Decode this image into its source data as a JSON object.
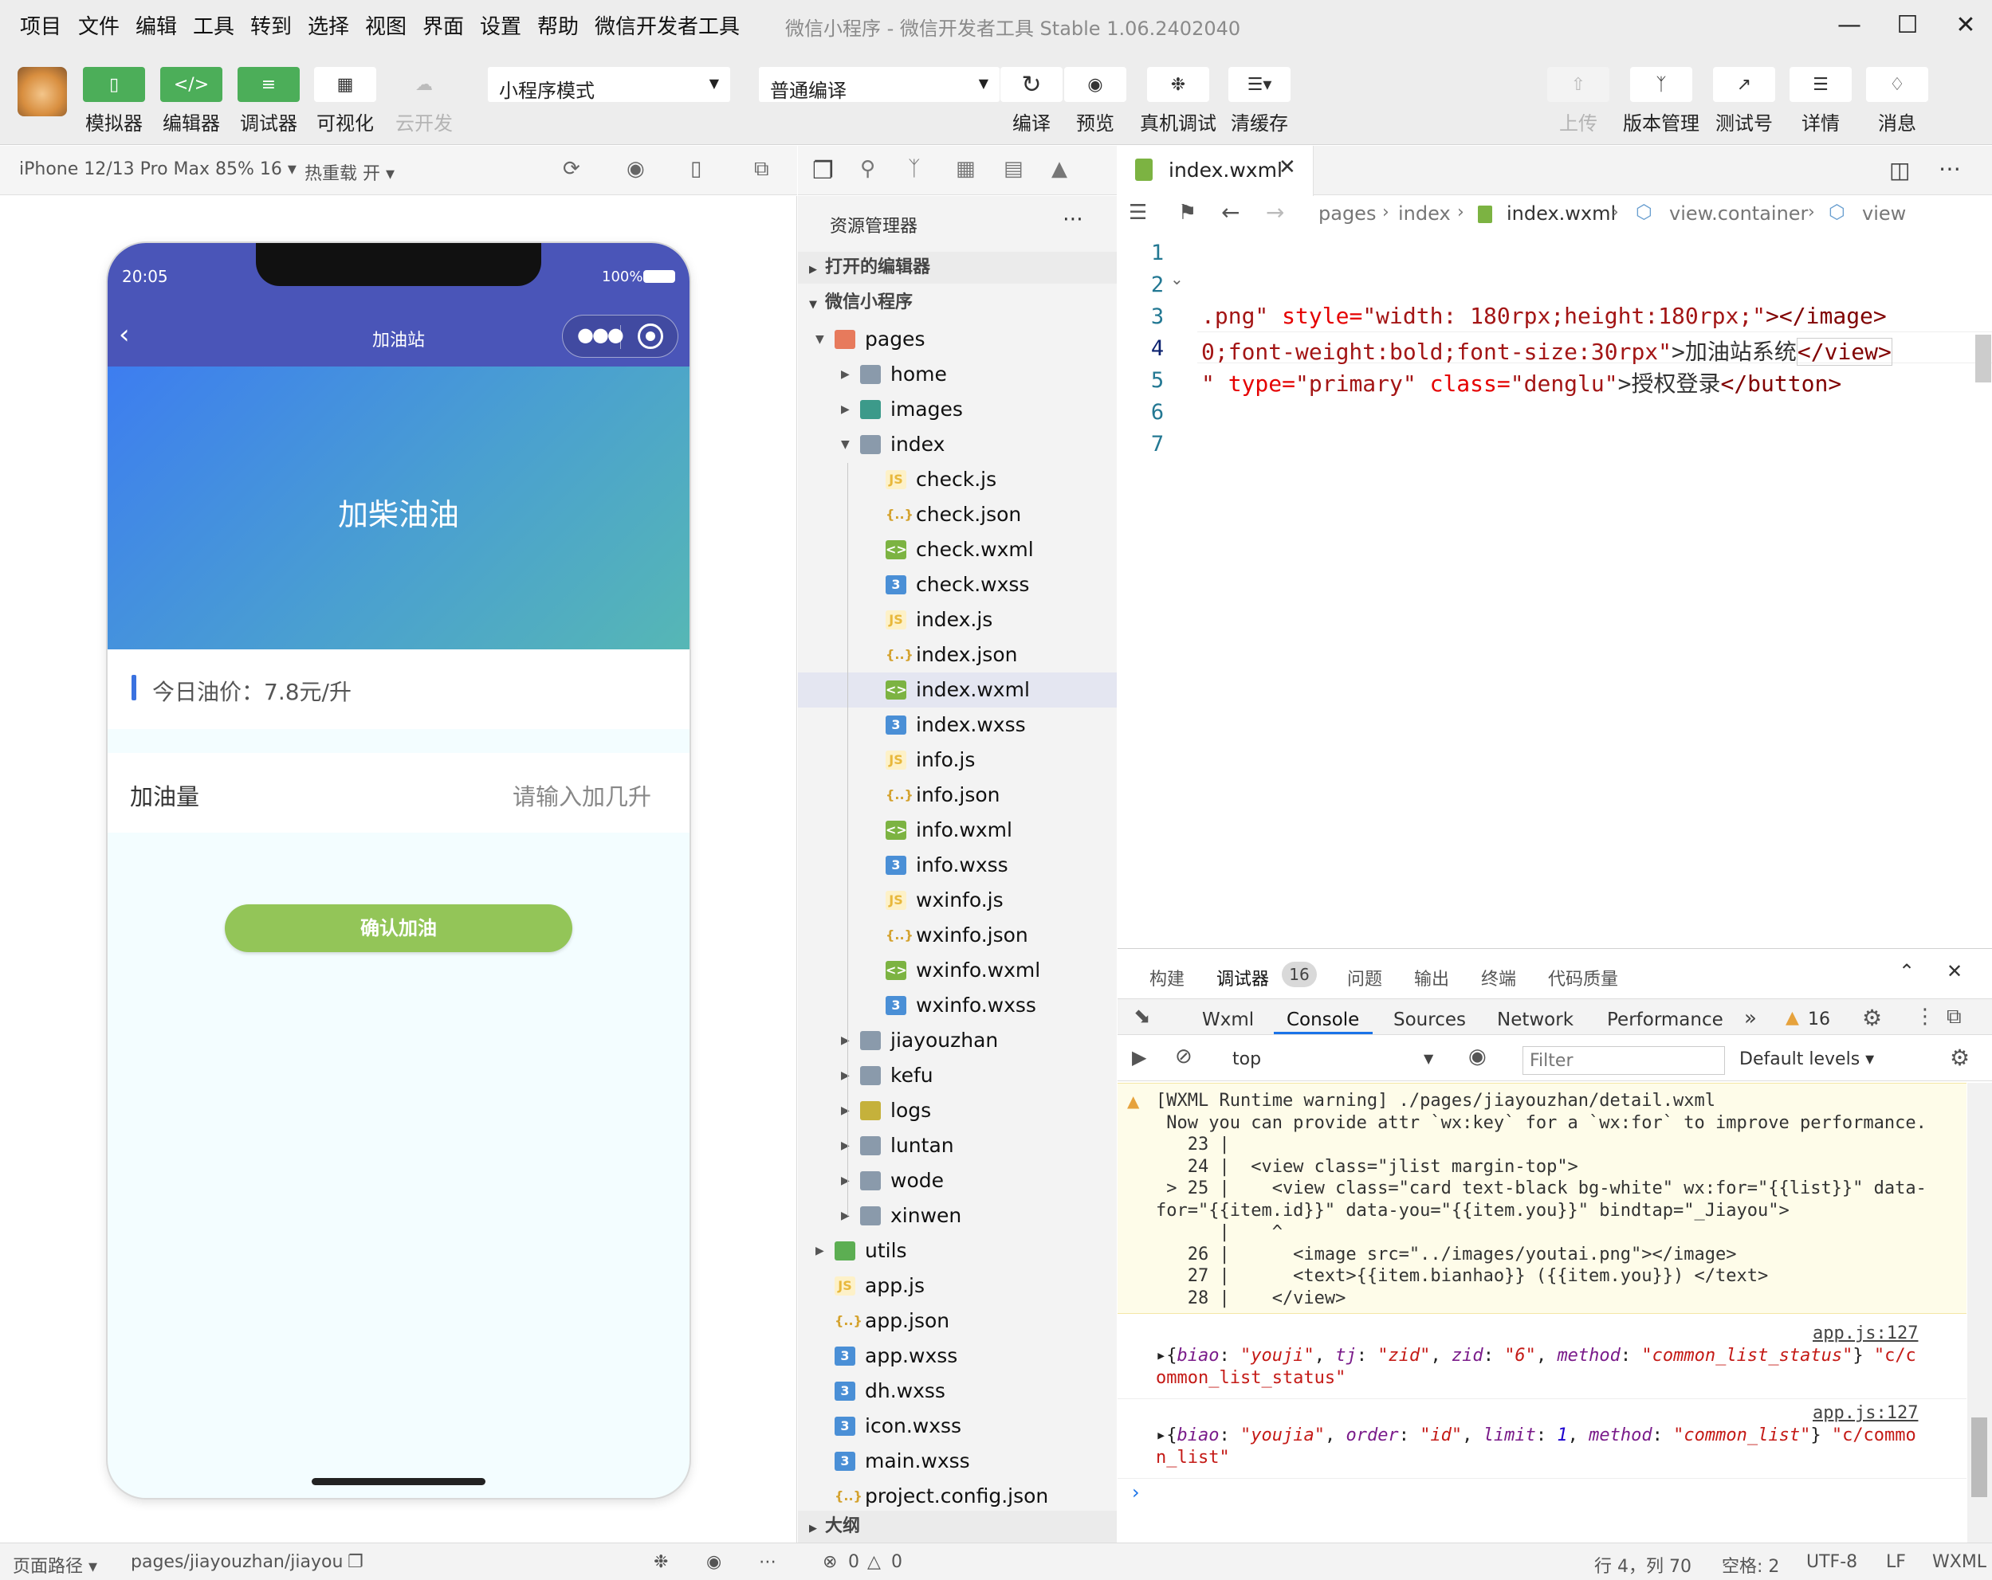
{
  "menu": [
    "项目",
    "文件",
    "编辑",
    "工具",
    "转到",
    "选择",
    "视图",
    "界面",
    "设置",
    "帮助",
    "微信开发者工具"
  ],
  "window_title": "微信小程序 - 微信开发者工具 Stable 1.06.2402040",
  "toolbar": {
    "simulator": "模拟器",
    "editor": "编辑器",
    "debugger": "调试器",
    "visual": "可视化",
    "cloud": "云开发",
    "mode": "小程序模式",
    "compile_mode": "普通编译",
    "compile": "编译",
    "preview": "预览",
    "real_debug": "真机调试",
    "clear_cache": "清缓存",
    "upload": "上传",
    "version": "版本管理",
    "test": "测试号",
    "detail": "详情",
    "message": "消息"
  },
  "simbar": {
    "device": "iPhone 12/13 Pro Max 85% 16 ▾",
    "hot_reload": "热重载 开 ▾"
  },
  "phone": {
    "time": "20:05",
    "battery": "100%",
    "nav_title": "加油站",
    "banner_title": "加柴油油",
    "price": "今日油价：7.8元/升",
    "qty_label": "加油量",
    "qty_placeholder": "请输入加几升",
    "confirm": "确认加油"
  },
  "explorer": {
    "title": "资源管理器",
    "open_editors": "打开的编辑器",
    "project": "微信小程序",
    "outline": "大纲",
    "tree": [
      {
        "name": "pages",
        "depth": 0,
        "type": "folder-open",
        "icon": "folder-pages-icon"
      },
      {
        "name": "home",
        "depth": 1,
        "type": "folder",
        "icon": "folder-icon"
      },
      {
        "name": "images",
        "depth": 1,
        "type": "folder",
        "icon": "folder-images-icon"
      },
      {
        "name": "index",
        "depth": 1,
        "type": "folder-open",
        "icon": "folder-open-icon"
      },
      {
        "name": "check.js",
        "depth": 2,
        "type": "js"
      },
      {
        "name": "check.json",
        "depth": 2,
        "type": "json"
      },
      {
        "name": "check.wxml",
        "depth": 2,
        "type": "wxml"
      },
      {
        "name": "check.wxss",
        "depth": 2,
        "type": "wxss"
      },
      {
        "name": "index.js",
        "depth": 2,
        "type": "js"
      },
      {
        "name": "index.json",
        "depth": 2,
        "type": "json"
      },
      {
        "name": "index.wxml",
        "depth": 2,
        "type": "wxml",
        "selected": true
      },
      {
        "name": "index.wxss",
        "depth": 2,
        "type": "wxss"
      },
      {
        "name": "info.js",
        "depth": 2,
        "type": "js"
      },
      {
        "name": "info.json",
        "depth": 2,
        "type": "json"
      },
      {
        "name": "info.wxml",
        "depth": 2,
        "type": "wxml"
      },
      {
        "name": "info.wxss",
        "depth": 2,
        "type": "wxss"
      },
      {
        "name": "wxinfo.js",
        "depth": 2,
        "type": "js"
      },
      {
        "name": "wxinfo.json",
        "depth": 2,
        "type": "json"
      },
      {
        "name": "wxinfo.wxml",
        "depth": 2,
        "type": "wxml"
      },
      {
        "name": "wxinfo.wxss",
        "depth": 2,
        "type": "wxss"
      },
      {
        "name": "jiayouzhan",
        "depth": 1,
        "type": "folder"
      },
      {
        "name": "kefu",
        "depth": 1,
        "type": "folder"
      },
      {
        "name": "logs",
        "depth": 1,
        "type": "folder-logs"
      },
      {
        "name": "luntan",
        "depth": 1,
        "type": "folder"
      },
      {
        "name": "wode",
        "depth": 1,
        "type": "folder"
      },
      {
        "name": "xinwen",
        "depth": 1,
        "type": "folder"
      },
      {
        "name": "utils",
        "depth": 0,
        "type": "folder-utils"
      },
      {
        "name": "app.js",
        "depth": 0,
        "type": "js"
      },
      {
        "name": "app.json",
        "depth": 0,
        "type": "json"
      },
      {
        "name": "app.wxss",
        "depth": 0,
        "type": "wxss"
      },
      {
        "name": "dh.wxss",
        "depth": 0,
        "type": "wxss"
      },
      {
        "name": "icon.wxss",
        "depth": 0,
        "type": "wxss"
      },
      {
        "name": "main.wxss",
        "depth": 0,
        "type": "wxss"
      },
      {
        "name": "project.config.json",
        "depth": 0,
        "type": "json"
      }
    ]
  },
  "editor": {
    "tab": "index.wxml",
    "crumbs": [
      "pages",
      "index",
      "index.wxml",
      "view.container",
      "view"
    ],
    "line_numbers": [
      "1",
      "2",
      "3",
      "4",
      "5",
      "6",
      "7"
    ],
    "line3": [
      ".png\"",
      "style=",
      "\"width: 180rpx;height:180rpx;\"",
      "></image>"
    ],
    "line4": [
      "0;font-weight:bold;font-size:30rpx\"",
      ">加油站系统",
      "</view>"
    ],
    "line5": [
      "\"",
      "type=",
      "\"primary\"",
      "class=",
      "\"denglu\"",
      ">授权登录",
      "</button>"
    ]
  },
  "panel": {
    "tabs": [
      "构建",
      "调试器",
      "问题",
      "输出",
      "终端",
      "代码质量"
    ],
    "badge": "16",
    "devtabs": [
      "Wxml",
      "Console",
      "Sources",
      "Network",
      "Performance"
    ],
    "warn_count": "16",
    "context": "top",
    "filter_placeholder": "Filter",
    "levels": "Default levels ▾",
    "warning": [
      "[WXML Runtime warning] ./pages/jiayouzhan/detail.wxml",
      " Now you can provide attr `wx:key` for a `wx:for` to improve performance.",
      "   23 |",
      "   24 |  <view class=\"jlist margin-top\">",
      " > 25 |    <view class=\"card text-black bg-white\" wx:for=\"{{list}}\" data-",
      "for=\"{{item.id}}\" data-you=\"{{item.you}}\" bindtap=\"_Jiayou\">",
      "      |    ^",
      "   26 |      <image src=\"../images/youtai.png\"></image>",
      "   27 |      <text>{{item.bianhao}} ({{item.you}}) </text>",
      "   28 |    </view>"
    ],
    "log_source": "app.js:127",
    "log1": {
      "k1": "biao",
      "v1": "\"youji\"",
      "k2": "tj",
      "v2": "\"zid\"",
      "k3": "zid",
      "v3": "\"6\"",
      "k4": "method",
      "v4": "\"common_list_status\"",
      "tail": " \"c/c",
      "tail2": "ommon_list_status\""
    },
    "log2": {
      "k1": "biao",
      "v1": "\"youjia\"",
      "k2": "order",
      "v2": "\"id\"",
      "k3": "limit",
      "v3": "1",
      "k4": "method",
      "v4": "\"common_list\"",
      "tail": " \"c/commo",
      "tail2": "n_list\""
    }
  },
  "statusbar": {
    "page_path_label": "页面路径 ▾",
    "page_path": "pages/jiayouzhan/jiayou",
    "errors": "0",
    "warnings": "0",
    "position": "行 4，列 70",
    "spaces": "空格: 2",
    "encoding": "UTF-8",
    "eol": "LF",
    "lang": "WXML"
  },
  "colors": {
    "accent_green": "#4cae59",
    "nav_blue": "#4a55b8",
    "confirm_green": "#93c558"
  }
}
